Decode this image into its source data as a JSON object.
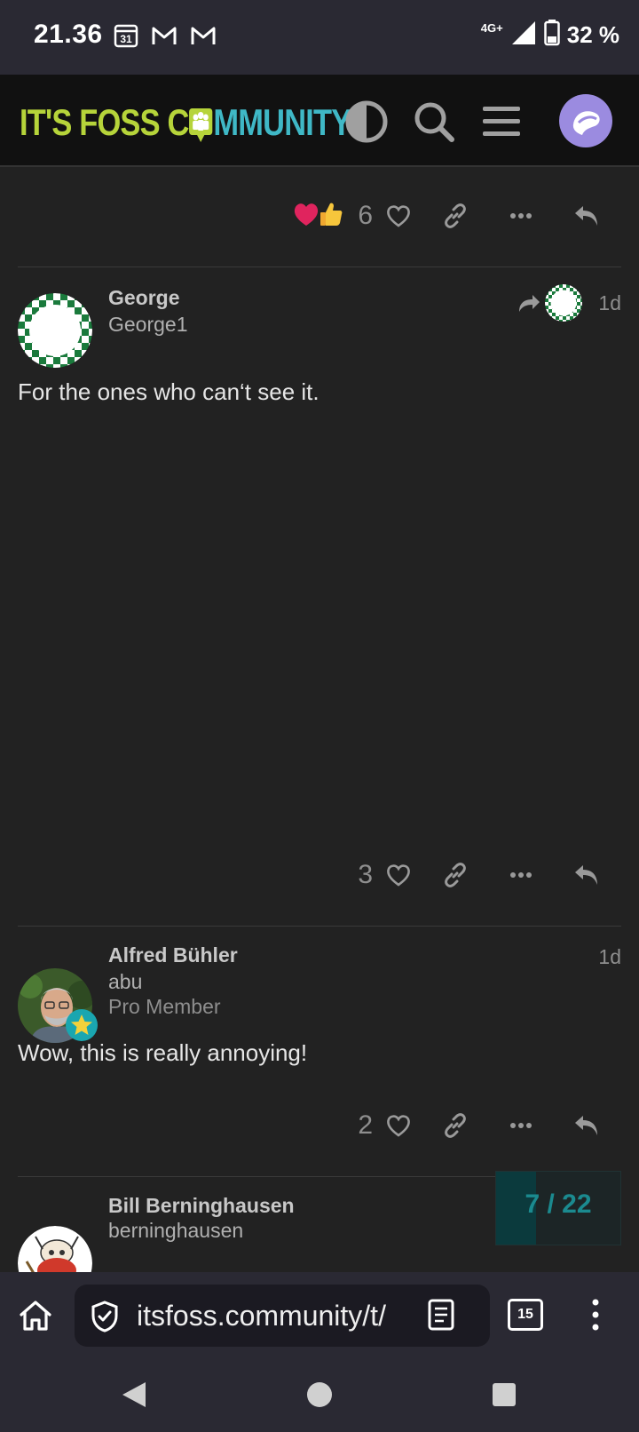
{
  "status_bar": {
    "time": "21.36",
    "calendar_day": "31",
    "network": "4G+",
    "battery": "32 %"
  },
  "header": {
    "logo_part1": "IT'S FOSS C",
    "logo_part2": "MMUNITY"
  },
  "posts": [
    {
      "likes": "6",
      "reactions": [
        "heart",
        "thumbs-up"
      ]
    },
    {
      "name": "George",
      "username": "George1",
      "date": "1d",
      "body": "For the ones who can‘t see it.",
      "likes": "3"
    },
    {
      "name": "Alfred Bühler",
      "username": "abu",
      "title": "Pro Member",
      "date": "1d",
      "body": "Wow, this is really annoying!",
      "likes": "2"
    },
    {
      "name": "Bill Berninghausen",
      "username": "berninghausen"
    }
  ],
  "progress": {
    "label": "7 / 22",
    "current": 7,
    "total": 22
  },
  "browser": {
    "url": "itsfoss.community/t/",
    "tab_count": "15"
  },
  "colors": {
    "accent": "#1b8a8f",
    "heart": "#e0245e",
    "logo_green": "#b6d43a",
    "logo_teal": "#3fb8c6"
  }
}
